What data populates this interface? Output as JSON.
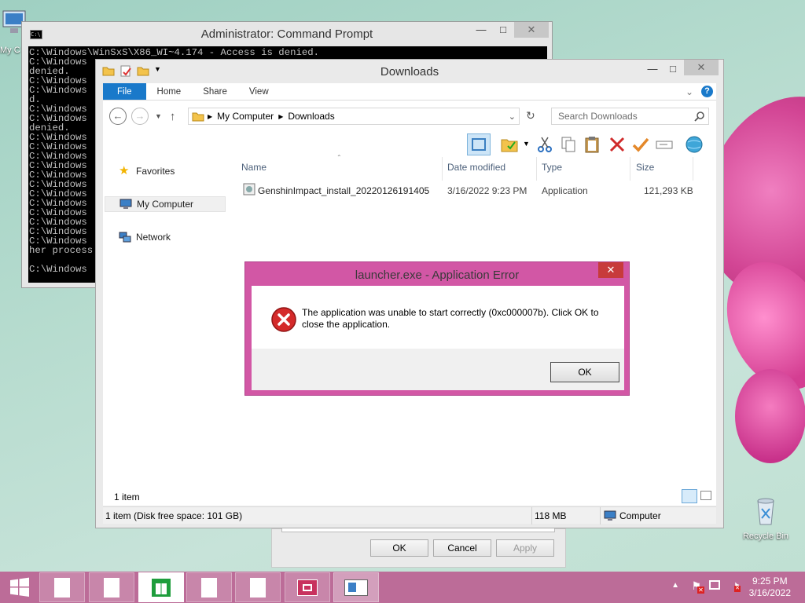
{
  "desktop": {
    "mycomputer_label": "My C",
    "recycle_bin_label": "Recycle Bin"
  },
  "cmd": {
    "title": "Administrator: Command Prompt",
    "lines": [
      "C:\\Windows\\WinSxS\\X86_WI~4.174 - Access is denied.",
      "C:\\Windows",
      "denied.",
      "C:\\Windows",
      "C:\\Windows",
      "d.",
      "C:\\Windows",
      "C:\\Windows",
      "denied.",
      "C:\\Windows",
      "C:\\Windows",
      "C:\\Windows",
      "C:\\Windows",
      "C:\\Windows",
      "C:\\Windows",
      "C:\\Windows",
      "C:\\Windows",
      "C:\\Windows",
      "C:\\Windows",
      "C:\\Windows",
      "C:\\Windows",
      "her process",
      "",
      "C:\\Windows"
    ]
  },
  "explorer": {
    "title": "Downloads",
    "tabs": [
      "File",
      "Home",
      "Share",
      "View"
    ],
    "breadcrumb": [
      "My Computer",
      "Downloads"
    ],
    "search_placeholder": "Search Downloads",
    "nav": [
      "Favorites",
      "My Computer",
      "Network"
    ],
    "columns": [
      "Name",
      "Date modified",
      "Type",
      "Size"
    ],
    "files": [
      {
        "name": "GenshinImpact_install_20220126191405",
        "date": "3/16/2022 9:23 PM",
        "type": "Application",
        "size": "121,293 KB"
      }
    ],
    "item_count": "1 item",
    "status_left": "1 item (Disk free space: 101 GB)",
    "status_size": "118 MB",
    "status_location": "Computer"
  },
  "properties_dialog": {
    "ok": "OK",
    "cancel": "Cancel",
    "apply": "Apply"
  },
  "error_dialog": {
    "title": "launcher.exe - Application Error",
    "message": "The application was unable to start correctly (0xc000007b). Click OK to close the application.",
    "ok": "OK"
  },
  "taskbar": {
    "time": "9:25 PM",
    "date": "3/16/2022"
  },
  "colors": {
    "accent": "#1979ca",
    "dialog_frame": "#d257a5",
    "taskbar": "#bc6c98",
    "close_red": "#c73b3b"
  }
}
